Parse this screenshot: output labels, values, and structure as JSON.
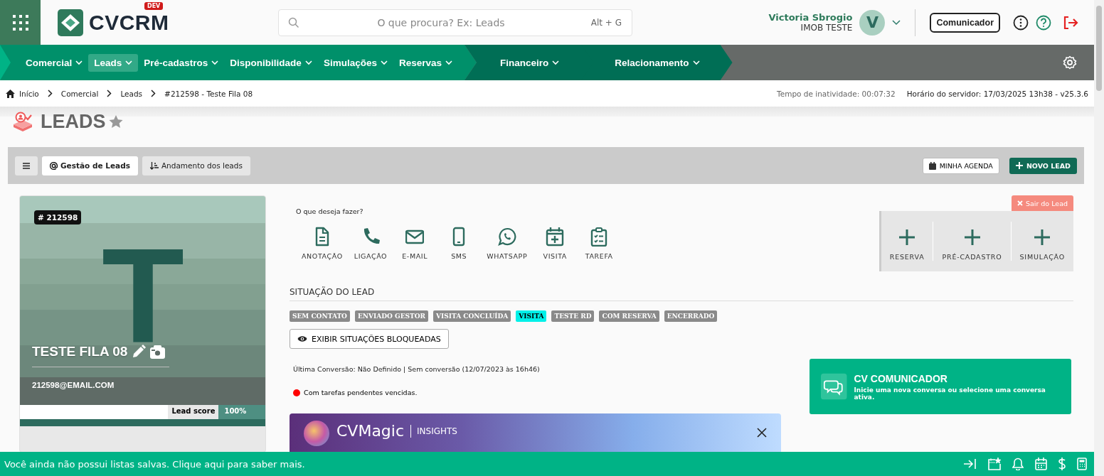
{
  "header": {
    "logo_text": "CVCRM",
    "logo_badge": "DEV",
    "search": {
      "placeholder": "O que procura? Ex: Leads",
      "shortcut": "Alt + G"
    },
    "user": {
      "name": "Victoria Sbrogio",
      "company": "IMOB TESTE",
      "initial": "V"
    },
    "communicator_button": "Comunicador"
  },
  "nav": {
    "items": [
      {
        "label": "Comercial",
        "selected": false,
        "kind": "main"
      },
      {
        "label": "Leads",
        "selected": true,
        "kind": "main"
      },
      {
        "label": "Pré-cadastros",
        "selected": false,
        "kind": "main"
      },
      {
        "label": "Disponibilidade",
        "selected": false,
        "kind": "main"
      },
      {
        "label": "Simulações",
        "selected": false,
        "kind": "main"
      },
      {
        "label": "Reservas",
        "selected": false,
        "kind": "main"
      },
      {
        "label": "Financeiro",
        "selected": false,
        "kind": "finance"
      },
      {
        "label": "Relacionamento",
        "selected": false,
        "kind": "relation"
      }
    ]
  },
  "breadcrumb": [
    "Início",
    "Comercial",
    "Leads",
    "#212598 - Teste Fila 08"
  ],
  "status": {
    "idle": "Tempo de inatividade: 00:07:32",
    "server": "Horário do servidor: 17/03/2025 13h38 - v25.3.6"
  },
  "page_title": "LEADS",
  "toolbar": {
    "tabs": [
      {
        "label": "Gestão de Leads",
        "selected": true
      },
      {
        "label": "Andamento dos leads",
        "selected": false
      }
    ],
    "agenda_button": "MINHA AGENDA",
    "new_lead_button": "NOVO LEAD"
  },
  "lead": {
    "id_badge": "# 212598",
    "initial": "T",
    "name": "TESTE FILA 08",
    "email": "212598@EMAIL.COM",
    "score_label": "Lead score",
    "score": "100%",
    "level": 1
  },
  "actions": {
    "prompt": "O que deseja fazer?",
    "items": [
      {
        "label": "ANOTAÇÃO",
        "kind": "note"
      },
      {
        "label": "LIGAÇÃO",
        "kind": "call"
      },
      {
        "label": "E-MAIL",
        "kind": "email"
      },
      {
        "label": "SMS",
        "kind": "sms"
      },
      {
        "label": "WHATSAPP",
        "kind": "whatsapp"
      },
      {
        "label": "VISITA",
        "kind": "visit"
      },
      {
        "label": "TAREFA",
        "kind": "task"
      }
    ]
  },
  "exit_button": "Sair do Lead",
  "quick_add": [
    "RESERVA",
    "PRÉ-CADASTRO",
    "SIMULAÇÃO"
  ],
  "situation": {
    "title": "SITUAÇÃO DO LEAD",
    "items": [
      {
        "label": "SEM CONTATO",
        "selected": false
      },
      {
        "label": "ENVIADO GESTOR",
        "selected": false
      },
      {
        "label": "VISITA CONCLUÍDA",
        "selected": false
      },
      {
        "label": "VISITA",
        "selected": true
      },
      {
        "label": "TESTE RD",
        "selected": false
      },
      {
        "label": "COM RESERVA",
        "selected": false
      },
      {
        "label": "ENCERRADO",
        "selected": false
      }
    ],
    "blocked_button": "EXIBIR SITUAÇÕES BLOQUEADAS"
  },
  "last_conversion": "Última Conversão: Não Definido | Sem conversão (12/07/2023 às 16h46)",
  "overdue_tasks": {
    "text": "Com tarefas pendentes vencidas.",
    "color": "#ff0000"
  },
  "insights_banner": {
    "title": "CVMagic",
    "subtitle": "INSIGHTS"
  },
  "communicator_card": {
    "title": "CV COMUNICADOR",
    "text": "Inicie uma nova conversa ou selecione uma conversa ativa."
  },
  "footer": {
    "message": "Você ainda não possui listas salvas. Clique aqui para saber mais."
  }
}
